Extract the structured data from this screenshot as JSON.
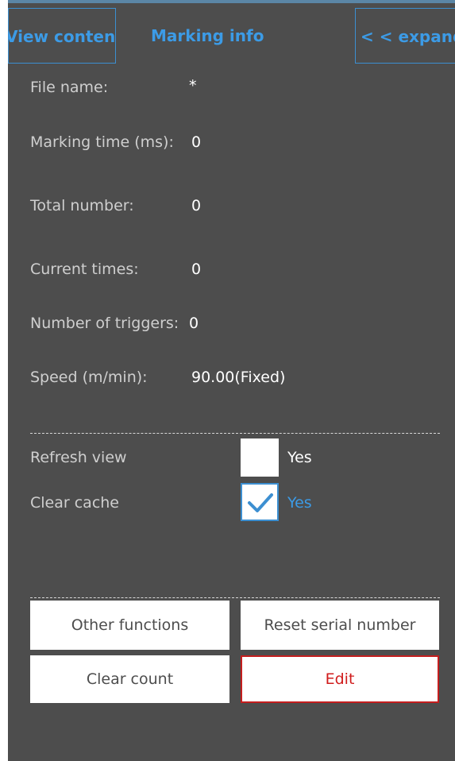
{
  "header": {
    "view_content_tab": "View content",
    "marking_info_tab": "Marking info",
    "expand_tab": "< < expand"
  },
  "info": {
    "file_name_label": "File name:",
    "file_name_value": "*",
    "marking_time_label": "Marking time (ms):",
    "marking_time_value": "0",
    "total_number_label": "Total number:",
    "total_number_value": "0",
    "current_times_label": "Current times:",
    "current_times_value": "0",
    "triggers_label": "Number of triggers:",
    "triggers_value": "0",
    "speed_label": "Speed (m/min):",
    "speed_value": "90.00(Fixed)"
  },
  "options": {
    "refresh_view_label": "Refresh view",
    "refresh_view_checked": false,
    "refresh_view_yes": "Yes",
    "clear_cache_label": "Clear cache",
    "clear_cache_checked": true,
    "clear_cache_yes": "Yes"
  },
  "buttons": {
    "other_functions": "Other functions",
    "reset_serial_number": "Reset serial number",
    "clear_count": "Clear count",
    "edit": "Edit"
  },
  "colors": {
    "panel_bg": "#4d4d4d",
    "accent_blue": "#3c9be6",
    "edit_red": "#d01c1c"
  }
}
